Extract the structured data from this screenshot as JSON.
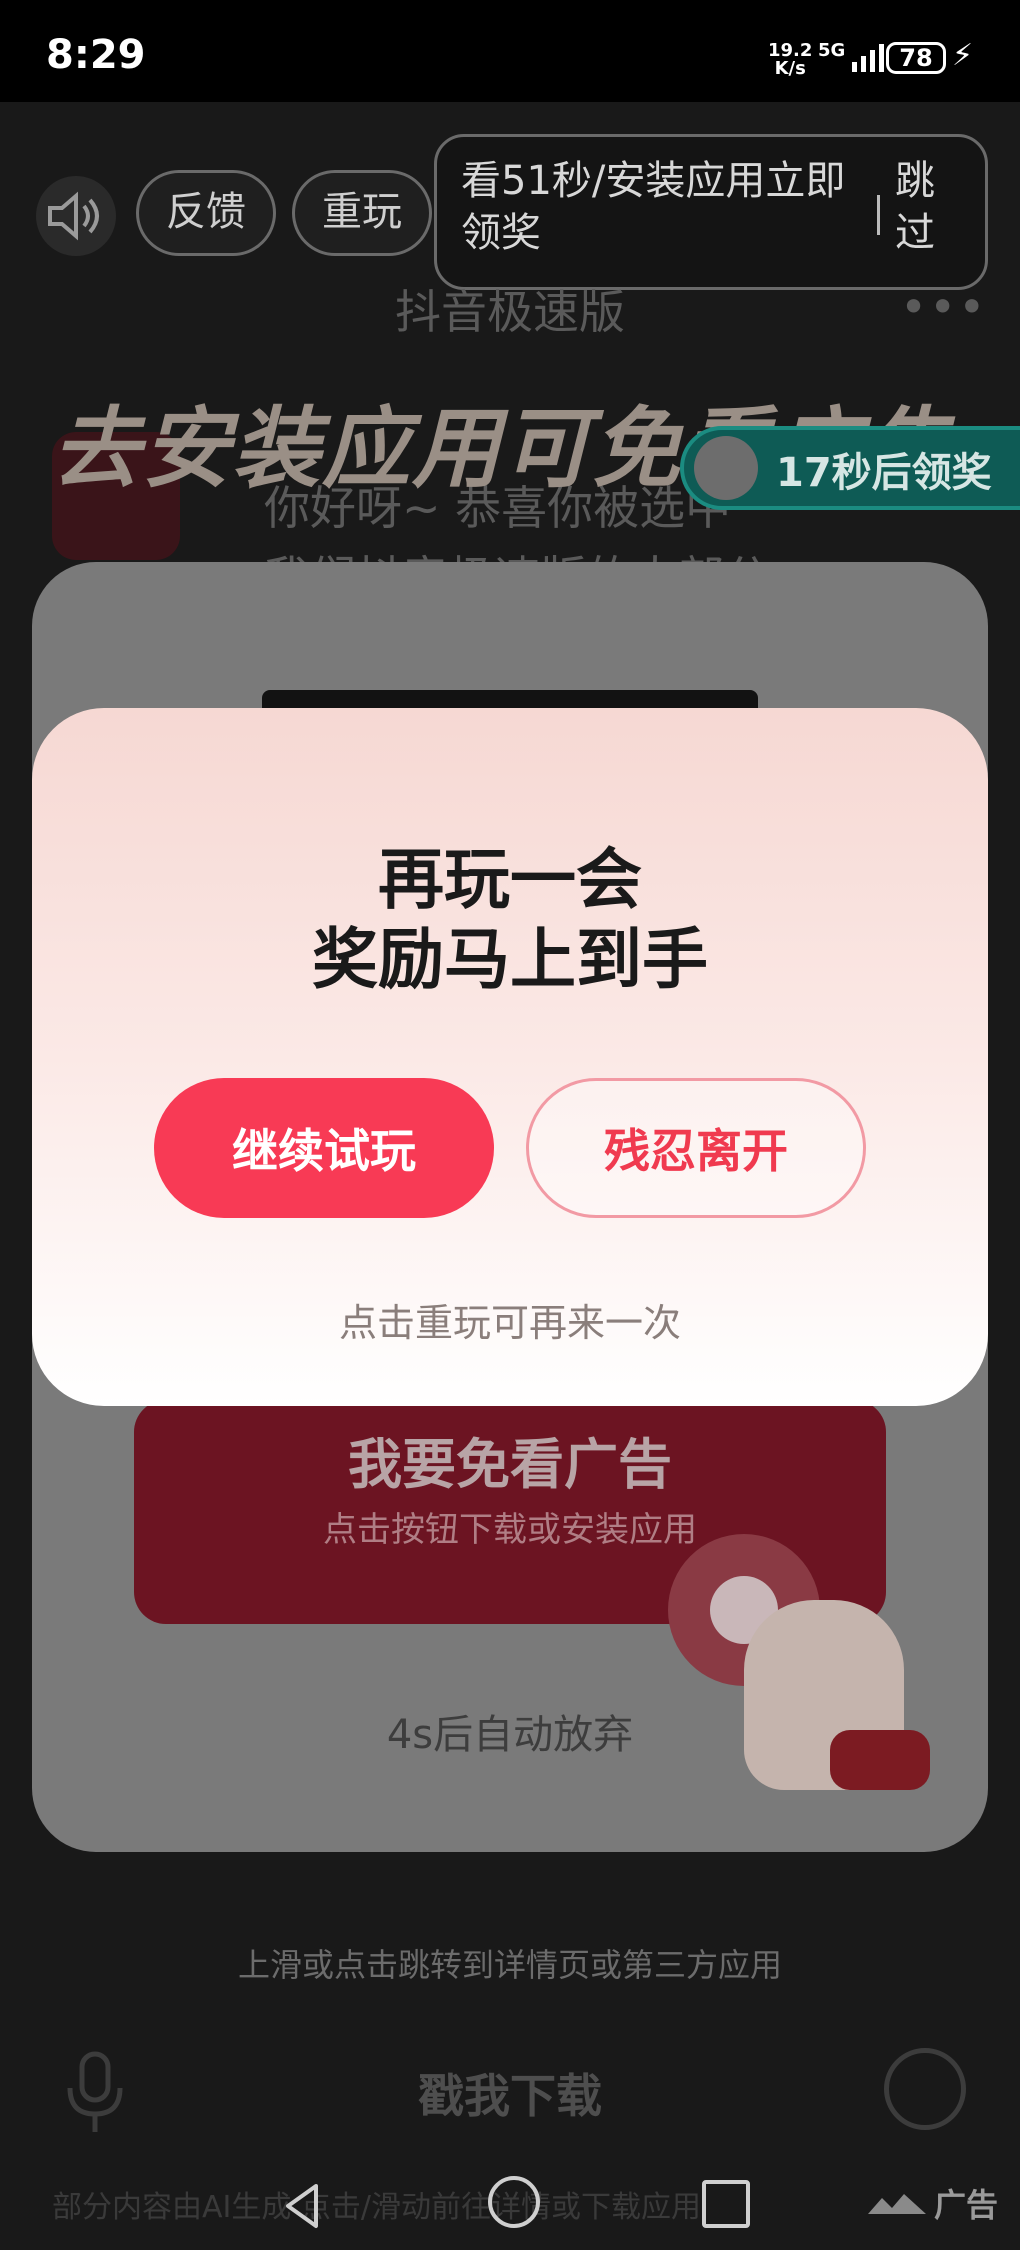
{
  "status_bar": {
    "time": "8:29",
    "net_speed_value": "19.2",
    "net_speed_unit": "K/s",
    "network": "5G",
    "battery": "78"
  },
  "ad_header": {
    "feedback_label": "反馈",
    "replay_label": "重玩",
    "reward_text": "看51秒/安装应用立即领奖",
    "skip_label": "跳过"
  },
  "ad_page": {
    "app_title": "抖音极速版",
    "banner": "去安装应用可免看广告",
    "intro_line1": "你好呀~ 恭喜你被选中",
    "intro_line2": "我们抖音极速版的大部分",
    "countdown_text": "17秒后领奖",
    "cta_main": "我要免看广告",
    "cta_sub": "点击按钮下载或安装应用",
    "auto_quit": "4s后自动放弃",
    "swipe_hint": "上滑或点击跳转到详情页或第三方应用",
    "download_label": "戳我下载",
    "disclaimer": "部分内容由AI生成 点击/滑动前往详情或下载应用",
    "ad_label": "广告"
  },
  "dialog": {
    "title_line1": "再玩一会",
    "title_line2": "奖励马上到手",
    "continue_label": "继续试玩",
    "leave_label": "残忍离开",
    "hint": "点击重玩可再来一次"
  },
  "colors": {
    "accent_red": "#f83a55",
    "dialog_top": "#f6d8d3",
    "countdown_green": "#0e5b55"
  }
}
